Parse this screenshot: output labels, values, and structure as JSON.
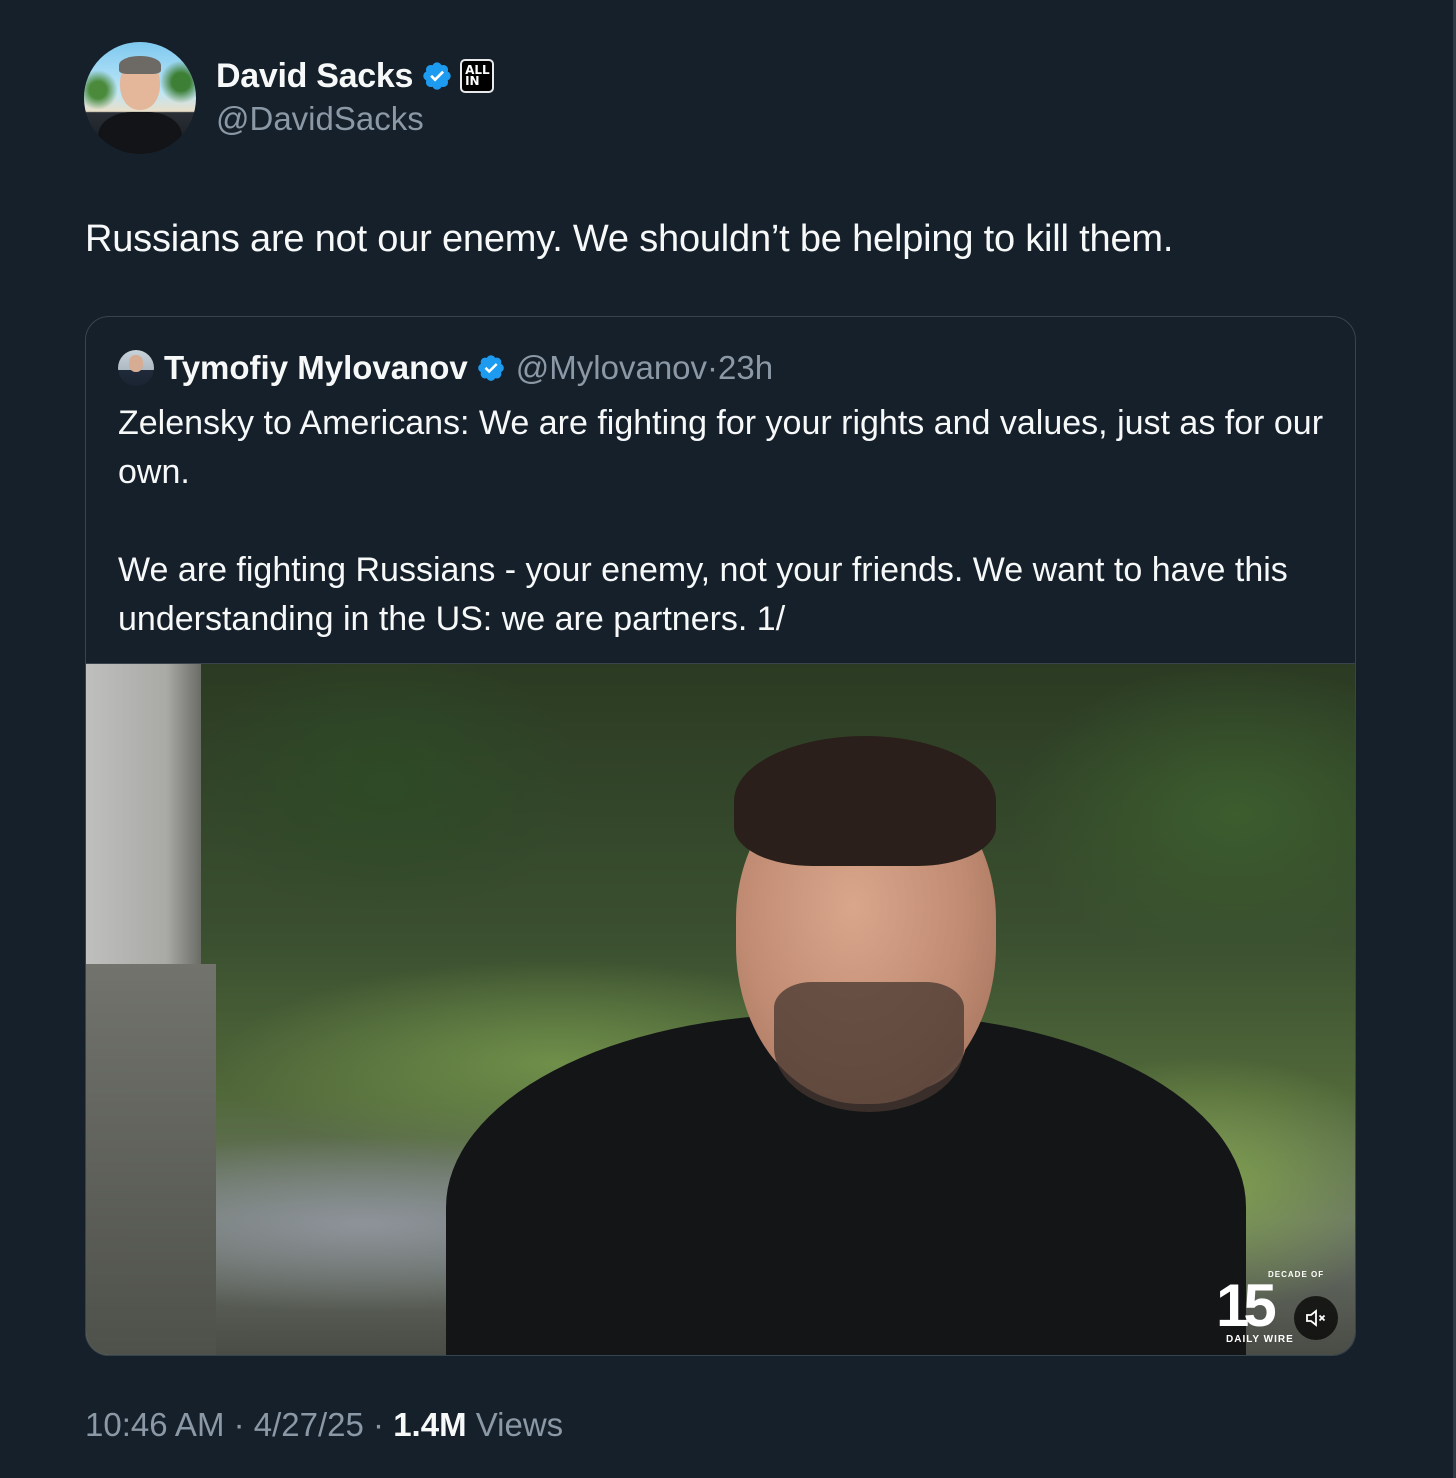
{
  "author": {
    "name": "David Sacks",
    "handle": "@DavidSacks",
    "affiliation_badge": [
      "ALL",
      "IN"
    ]
  },
  "tweet": {
    "text": "Russians are not our enemy. We shouldn’t be helping to kill them."
  },
  "quoted_tweet": {
    "name": "Tymofiy Mylovanov",
    "handle": "@Mylovanov",
    "separator": "·",
    "age": "23h",
    "text": "Zelensky to Americans: We are fighting for your rights and values, just as for our own.\n\nWe are fighting Russians - your enemy, not your friends. We want to have this understanding in the US: we are partners. 1/",
    "video": {
      "watermark_top": "DECADE OF",
      "watermark_number": "15",
      "watermark_bottom": "DAILY WIRE",
      "muted": true
    }
  },
  "meta": {
    "time": "10:46 AM",
    "sep1": " · ",
    "date": "4/27/25",
    "sep2": " · ",
    "views_count": "1.4M",
    "views_label": " Views"
  },
  "colors": {
    "background": "#15202b",
    "verified_blue": "#1d9bf0",
    "secondary_text": "#8b98a5",
    "border": "#38444d"
  },
  "icons": {
    "verified": "verified-badge-icon",
    "mute": "speaker-muted-icon"
  }
}
